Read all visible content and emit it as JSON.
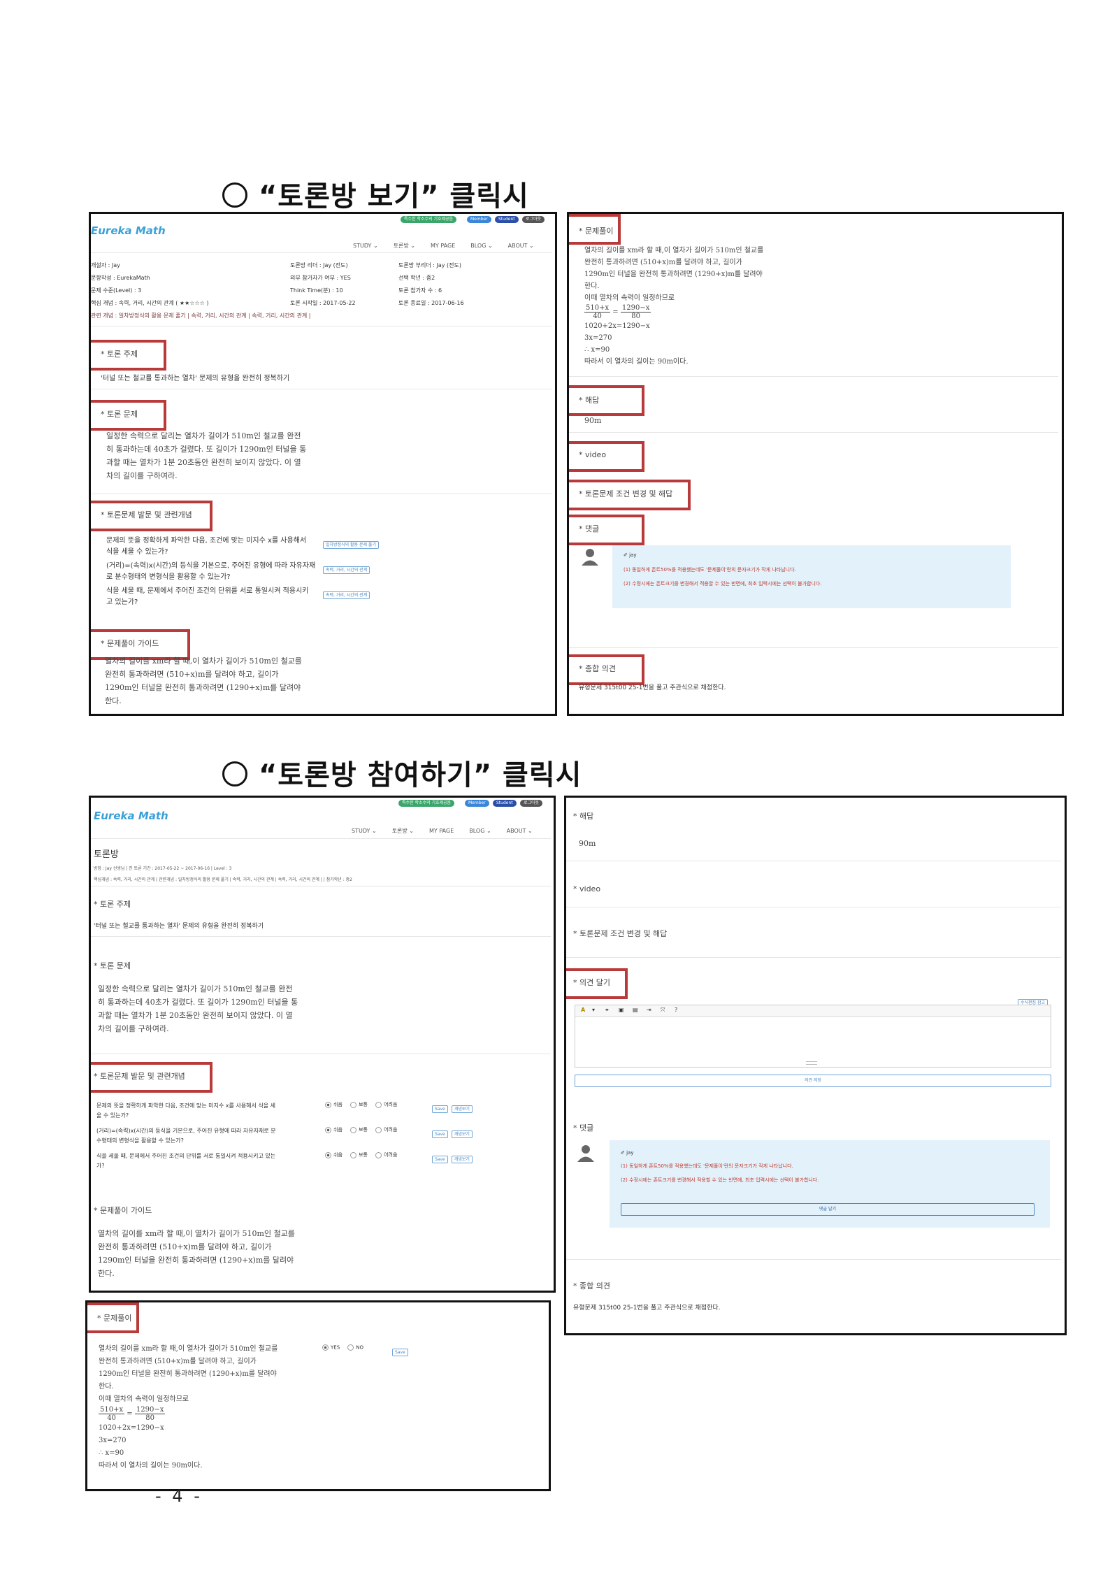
{
  "section1": {
    "title": "“토론방 보기” 클릭시"
  },
  "section2": {
    "title": "“토론방 참여하기” 클릭시"
  },
  "site": {
    "logo": "Eureka Math",
    "pills": [
      "특수한 학소수의 기호제공음",
      "Member",
      "Student",
      "로그아웃"
    ],
    "nav": [
      "STUDY ⌄",
      "토론방 ⌄",
      "MY PAGE",
      "BLOG ⌄",
      "ABOUT ⌄"
    ]
  },
  "view_left": {
    "meta_col1": [
      "개설자 : Jay",
      "문항작성 : EurekaMath",
      "문제 수준(Level) : 3",
      "핵심 개념 : 속력, 거리, 시간의 관계 ( ★★☆☆☆ )",
      "관련 개념 : 일차방정식의 활용 문제 풀기 | 속력, 거리, 시간의 관계 | 속력, 거리, 시간의 관계 |"
    ],
    "meta_col2": [
      "토론방 리더 : Jay (전도)",
      "외부 참가자가 여부 : YES",
      "Think Time(분) : 10",
      "토론 시작일 : 2017-05-22"
    ],
    "meta_col3": [
      "토론방 부리더 : Jay (전도)",
      "선택 학년 : 중2",
      "토론 참가자 수 : 6",
      "토론 종료일 : 2017-06-16"
    ],
    "topic_label": "* 토론 주제",
    "topic_text": "'터널 또는 철교를 통과하는 열차' 문제의 유형을 완전히 정복하기",
    "problem_label": "* 토론 문제",
    "problem_lines": [
      "일정한 속력으로 달리는 열차가 길이가 510m인 철교를 완전",
      "히 통과하는데 40초가 걸렸다. 또 길이가 1290m인 터널을 통",
      "과할 때는 열차가 1분 20초동안 완전히 보이지 않았다. 이 열",
      "차의 길이를 구하여라."
    ],
    "questions_label": "* 토론문제 발문 및 관련개념",
    "questions": [
      {
        "text": [
          "문제의 뜻을 정확하게 파악한 다음, 조건에 맞는 미지수 x를 사용해서",
          "식을 세울 수 있는가?"
        ],
        "tag": "일차방정식의 활용 문제 풀기"
      },
      {
        "text": [
          "(거리)=(속력)x(시간)의 등식을 기본으로, 주어진 유형에 따라 자유자재",
          "로 분수형태의 변형식을 활용할 수 있는가?"
        ],
        "tag": "속력, 거리, 시간의 관계"
      },
      {
        "text": [
          "식을 세울 때, 문제에서 주어진 조건의 단위를 서로 통일시켜 적용시키",
          "고 있는가?"
        ],
        "tag": "속력, 거리, 시간의 관계"
      }
    ],
    "guide_label": "* 문제풀이 가이드",
    "guide_lines": [
      "열차의 길이를 xm라 할 때,이 열차가 길이가 510m인 철교를",
      "완전히 통과하려면 (510+x)m를 달려야 하고, 길이가",
      "1290m인 터널을 완전히 통과하려면 (1290+x)m를 달려야",
      "한다."
    ]
  },
  "view_right": {
    "solution_label": "* 문제풀이",
    "solution_lines": [
      "열차의 길이를 xm라 할 때,이 열차가 길이가 510m인 철교를",
      "완전히 통과하려면 (510+x)m를 달려야 하고, 길이가",
      "1290m인 터널을 완전히 통과하려면 (1290+x)m를 달려야",
      "한다.",
      "이때 열차의 속력이 일정하므로"
    ],
    "frac_left_num": "510+x",
    "frac_left_den": "40",
    "frac_eq": "=",
    "frac_right_num": "1290−x",
    "frac_right_den": "80",
    "solution_lines2": [
      "1020+2x=1290−x",
      "3x=270",
      "∴ x=90",
      "따라서 이 열차의 길이는 90m이다."
    ],
    "answer_label": "* 해답",
    "answer_value": "90m",
    "video_label": "* video",
    "variation_label": "* 토론문제 조건 변경 및 해답",
    "comment_label": "* 댓글",
    "comment_user": "✐ jay",
    "comment_lines": [
      "(1) 동일하게 존트50%를 적용했는데도 '문제풀이'란의 문자크기가 작게 나타납니다.",
      "(2) 수정시에는 존트크기를 변경해서 적용할 수 있는 반면에, 최초 입력시에는 선택이 불가합니다."
    ],
    "summary_label": "* 종합 의견",
    "summary_text": "유형문제 315t00 25-1번을 풀고 주관식으로 채점한다."
  },
  "join_left": {
    "page_title": "토론방",
    "meta_line1": "방장 : Jay 선생님  |  진 토론 기간 : 2017-05-22 ~ 2017-06-16  |  Level : 3",
    "meta_line2": "핵심개념 : 속력, 거리, 시간의 관계  |  관련개념 : 일차방정식의 활용 문제 풀기 | 속력, 거리, 시간의 관계 | 속력, 거리, 시간의 관계 |  |  참가학년 :  중2",
    "topic_label": "* 토론 주제",
    "topic_text": "'터널 또는 철교를 통과하는 열차' 문제의 유형을 완전히 정복하기",
    "problem_label": "* 토론 문제",
    "questions_label": "* 토론문제 발문 및 관련개념",
    "questions": [
      [
        "문제의 뜻을 정확하게 파악한 다음, 조건에 맞는 미지수 x를 사용해서 식을 세",
        "울 수 있는가?"
      ],
      [
        "(거리)=(속력)x(시간)의 등식을 기본으로, 주어진 유형에 따라 자유자재로 분",
        "수형태의 변형식을 활용할 수 있는가?"
      ],
      [
        "식을 세울 때, 문제에서 주어진 조건의 단위를 서로 통일시켜 적용시키고 있는",
        "가?"
      ]
    ],
    "radio_labels": [
      "쉬움",
      "보통",
      "어려움"
    ],
    "save_label": "Save",
    "concept_label": "개념보기",
    "guide_label": "* 문제풀이 가이드"
  },
  "join_solution": {
    "label": "* 문제풀이",
    "yes": "YES",
    "no": "NO",
    "save": "Save"
  },
  "join_right": {
    "answer_label": "* 해답",
    "answer_value": "90m",
    "video_label": "* video",
    "variation_label": "* 토론문제 조건 변경 및 해답",
    "opinion_label": "* 의견 달기",
    "edit_help": "수식편집 참고",
    "toolbar": [
      "A",
      "▾",
      "⚭",
      "▣",
      "▤",
      "⇥",
      "⤧",
      "?"
    ],
    "opinion_save": "의견 저장",
    "comment_label": "* 댓글",
    "comment_user": "✐ jay",
    "reply_button": "댓글 달기",
    "summary_label": "* 종합 의견",
    "summary_text": "유형문제 315t00 25-1번을 풀고 주관식으로 채점한다."
  },
  "footer": {
    "page_number": "- 4 -"
  }
}
